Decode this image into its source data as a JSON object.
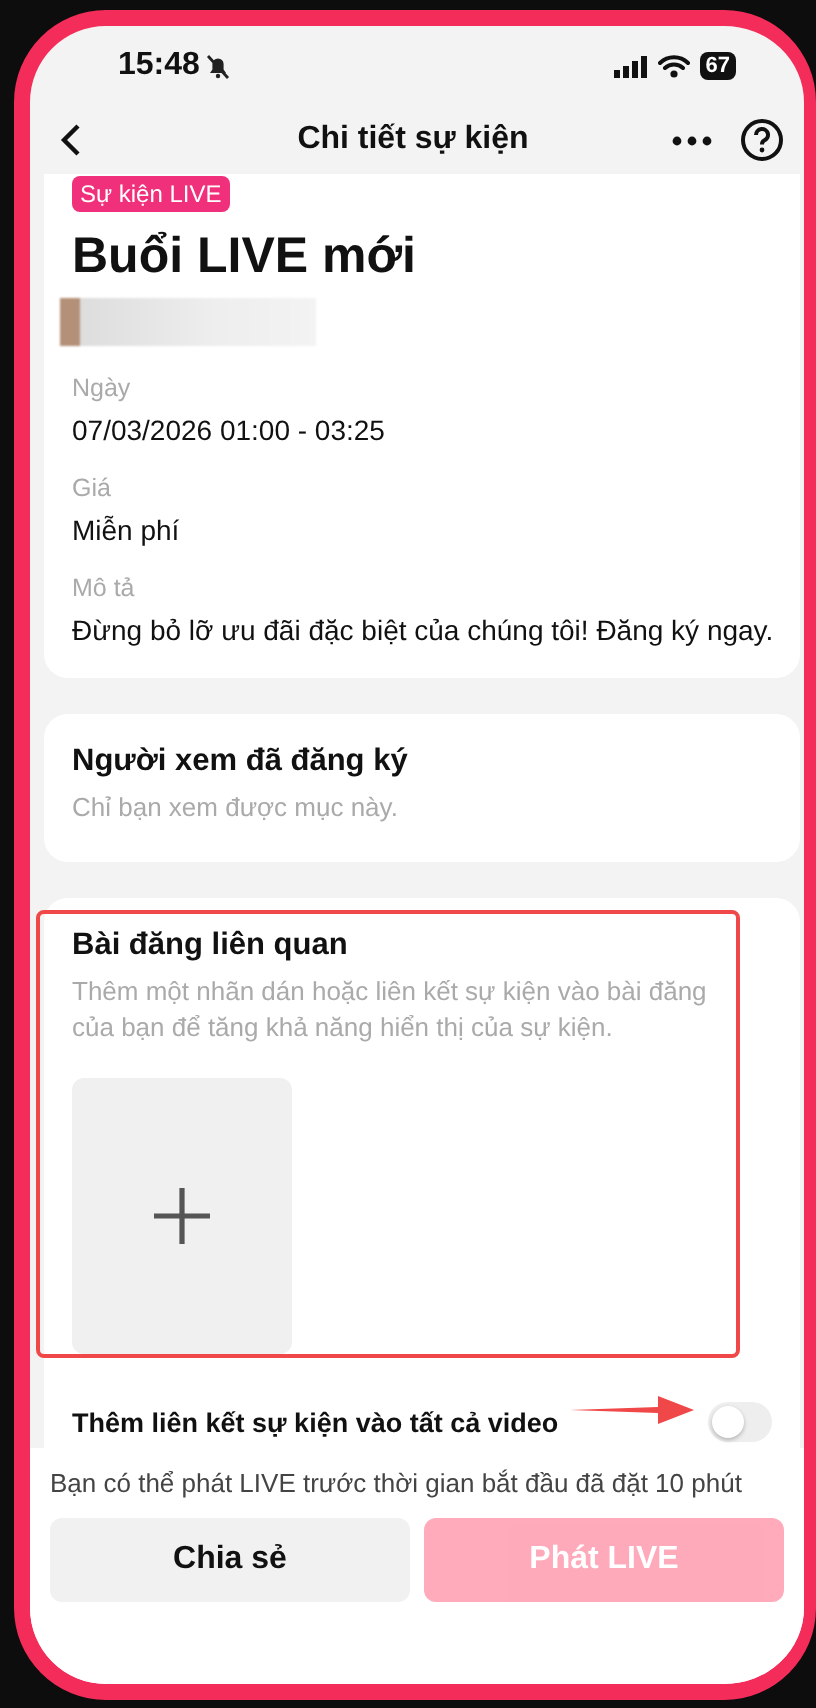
{
  "status_bar": {
    "time": "15:48",
    "silent": true,
    "battery": "67"
  },
  "nav": {
    "title": "Chi tiết sự kiện"
  },
  "event": {
    "tag": "Sự kiện LIVE",
    "title": "Buổi LIVE mới",
    "fields": [
      {
        "label": "Ngày",
        "value": "07/03/2026 01:00 - 03:25"
      },
      {
        "label": "Giá",
        "value": "Miễn phí"
      },
      {
        "label": "Mô tả",
        "value": "Đừng bỏ lỡ ưu đãi đặc biệt của chúng tôi! Đăng ký ngay."
      }
    ]
  },
  "viewers": {
    "title": "Người xem đã đăng ký",
    "subtitle": "Chỉ bạn xem được mục này."
  },
  "related_posts": {
    "title": "Bài đăng liên quan",
    "subtitle": "Thêm một nhãn dán hoặc liên kết sự kiện vào bài đăng của bạn để tăng khả năng hiển thị của sự kiện.",
    "toggle": {
      "label": "Thêm liên kết sự kiện vào tất cả video",
      "on": false
    }
  },
  "footer": {
    "note": "Bạn có thể phát LIVE trước thời gian bắt đầu đã đặt 10 phút",
    "buttons": [
      {
        "label": "Chia sẻ",
        "kind": "secondary",
        "disabled": false
      },
      {
        "label": "Phát LIVE",
        "kind": "primary",
        "disabled": true
      }
    ]
  }
}
